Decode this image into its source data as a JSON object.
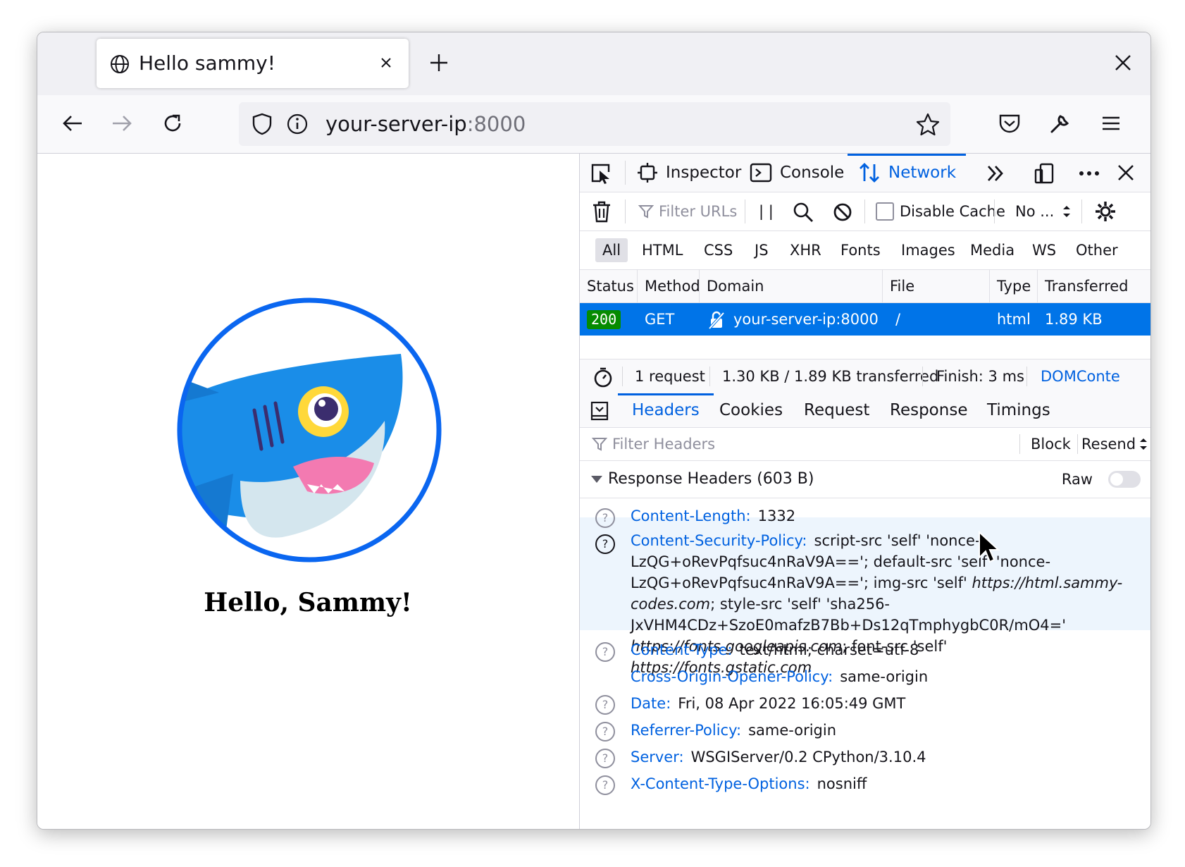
{
  "browser": {
    "tab_title": "Hello sammy!",
    "url_host": "your-server-ip",
    "url_port": ":8000"
  },
  "page": {
    "heading": "Hello, Sammy!"
  },
  "devtools": {
    "tabs": [
      "Inspector",
      "Console",
      "Network"
    ],
    "toolbar": {
      "filter_placeholder": "Filter URLs",
      "pause": "| |",
      "disable_cache_label": "Disable Cache",
      "throttle_value": "No ..."
    },
    "type_filters": [
      "All",
      "HTML",
      "CSS",
      "JS",
      "XHR",
      "Fonts",
      "Images",
      "Media",
      "WS",
      "Other"
    ],
    "columns": [
      "Status",
      "Method",
      "Domain",
      "File",
      "Type",
      "Transferred"
    ],
    "request": {
      "status": "200",
      "method": "GET",
      "domain": "your-server-ip:8000",
      "file": "/",
      "type": "html",
      "transferred": "1.89 KB"
    },
    "summary": {
      "requests": "1 request",
      "transferred": "1.30 KB / 1.89 KB transferred",
      "finish": "Finish: 3 ms",
      "domcontent": "DOMConte"
    },
    "subtabs": [
      "Headers",
      "Cookies",
      "Request",
      "Response",
      "Timings"
    ],
    "filter_headers_placeholder": "Filter Headers",
    "block_label": "Block",
    "resend_label": "Resend",
    "response_headers_title": "Response Headers (603 B)",
    "raw_label": "Raw",
    "headers": [
      {
        "name": "Content-Length:",
        "value": "1332"
      },
      {
        "name": "Content-Security-Policy:",
        "value_parts": [
          "script-src 'self' 'nonce-LzQG+oRevPqfsuc4nRaV9A=='; default-src 'self' 'nonce-LzQG+oRevPqfsuc4nRaV9A=='; img-src 'self' ",
          "https://html.sammy-codes.com",
          "; style-src 'self' 'sha256-JxVHM4CDz+SzoE0mafzB7Bb+Ds12qTmphygbC0R/mO4=' ",
          "https://fonts.googleapis.com",
          "; font-src 'self' ",
          "https://fonts.gstatic.com"
        ]
      },
      {
        "name": "Content-Type:",
        "value": "text/html; charset=utf-8"
      },
      {
        "name": "Cross-Origin-Opener-Policy:",
        "value": "same-origin"
      },
      {
        "name": "Date:",
        "value": "Fri, 08 Apr 2022 16:05:49 GMT"
      },
      {
        "name": "Referrer-Policy:",
        "value": "same-origin"
      },
      {
        "name": "Server:",
        "value": "WSGIServer/0.2 CPython/3.10.4"
      },
      {
        "name": "X-Content-Type-Options:",
        "value": "nosniff"
      }
    ]
  },
  "colors": {
    "accent": "#0061e0",
    "selected_row": "#0074e8",
    "status_ok": "#058b00",
    "logo_ring": "#0a66f0"
  }
}
